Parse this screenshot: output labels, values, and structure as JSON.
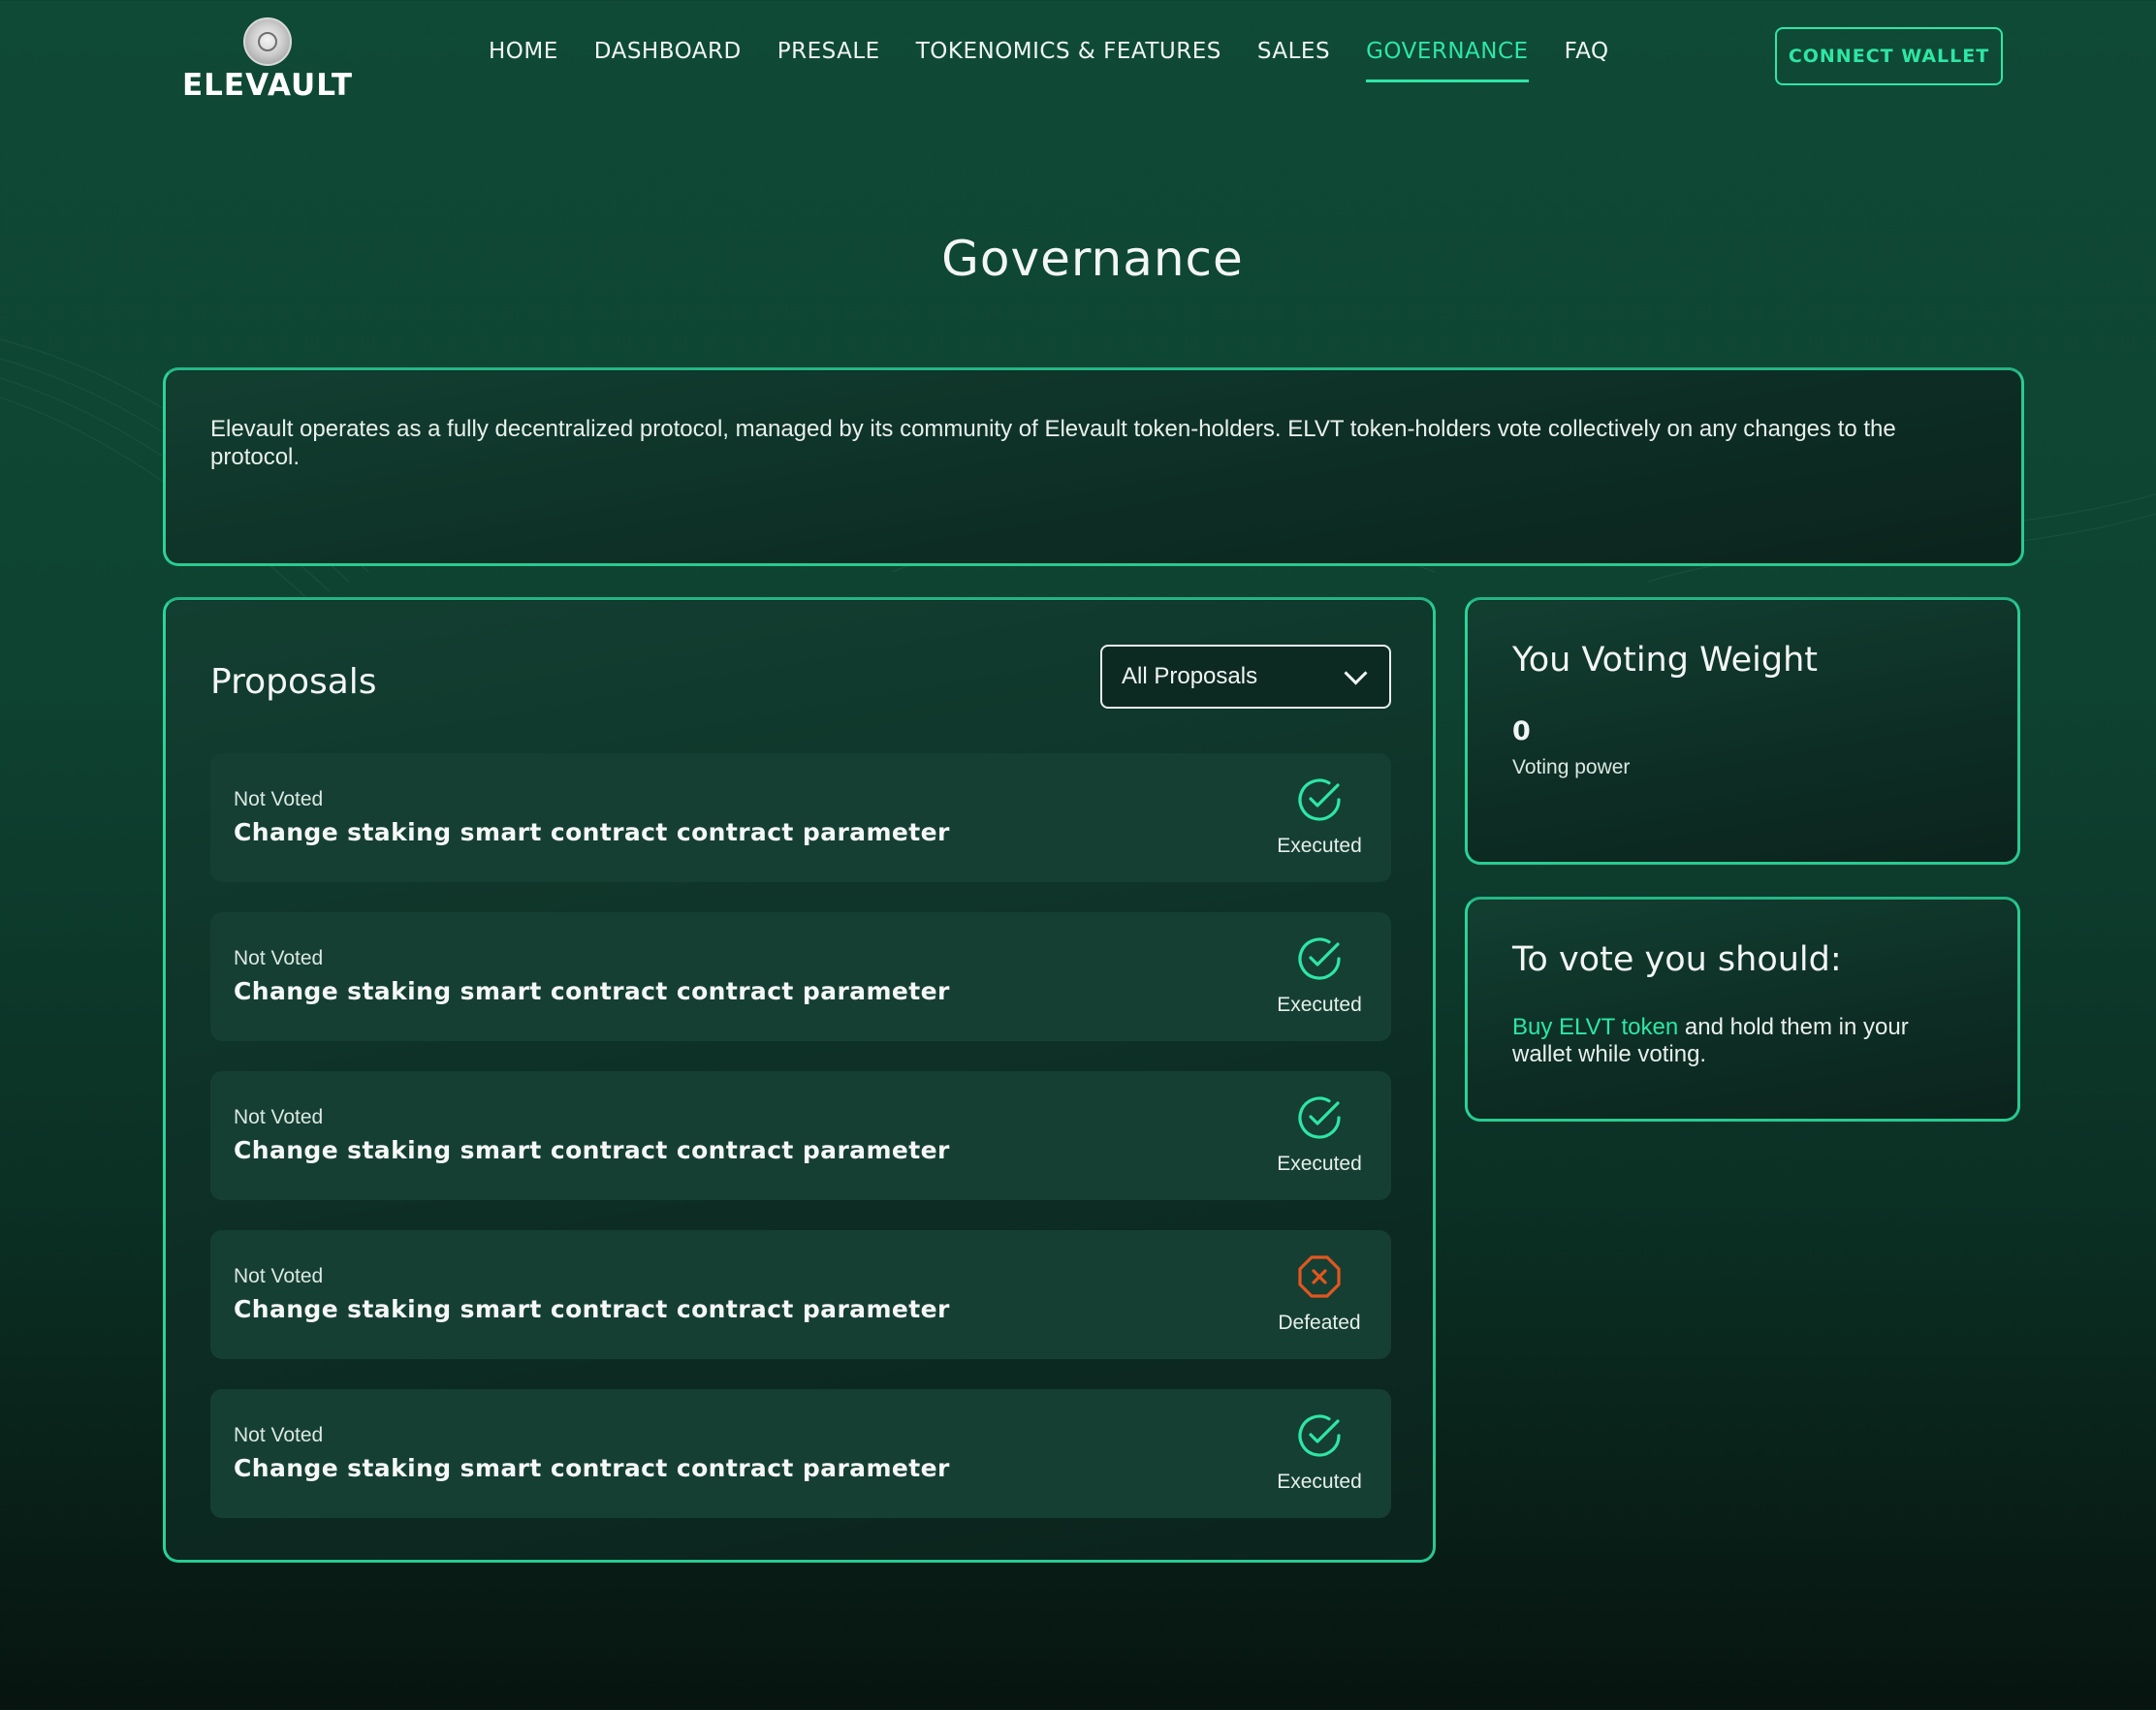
{
  "header": {
    "logo_text": "ELEVAULT",
    "nav": [
      {
        "label": "HOME",
        "active": false
      },
      {
        "label": "DASHBOARD",
        "active": false
      },
      {
        "label": "PRESALE",
        "active": false
      },
      {
        "label": "TOKENOMICS & FEATURES",
        "active": false
      },
      {
        "label": "SALES",
        "active": false
      },
      {
        "label": "GOVERNANCE",
        "active": true
      },
      {
        "label": "FAQ",
        "active": false
      }
    ],
    "connect_label": "CONNECT WALLET"
  },
  "page": {
    "title": "Governance",
    "intro": "Elevault operates as a fully decentralized protocol, managed by its community of Elevault token-holders.  ELVT token-holders vote collectively on any changes to the protocol."
  },
  "proposals": {
    "title": "Proposals",
    "filter_selected": "All Proposals",
    "items": [
      {
        "vote_status": "Not Voted",
        "title": "Change staking smart contract contract parameter",
        "state": "Executed",
        "icon": "check-circle-icon"
      },
      {
        "vote_status": "Not Voted",
        "title": "Change staking smart contract contract parameter",
        "state": "Executed",
        "icon": "check-circle-icon"
      },
      {
        "vote_status": "Not Voted",
        "title": "Change staking smart contract contract parameter",
        "state": "Executed",
        "icon": "check-circle-icon"
      },
      {
        "vote_status": "Not Voted",
        "title": "Change staking smart contract contract parameter",
        "state": "Defeated",
        "icon": "x-octagon-icon"
      },
      {
        "vote_status": "Not Voted",
        "title": "Change staking smart contract contract parameter",
        "state": "Executed",
        "icon": "check-circle-icon"
      }
    ]
  },
  "voting_weight": {
    "title": "You Voting Weight",
    "value": "0",
    "label": "Voting power"
  },
  "how_to_vote": {
    "title": "To vote you should:",
    "link_text": "Buy ELVT token",
    "rest_text": " and hold them in your wallet while voting."
  },
  "colors": {
    "accent": "#2ee6a6",
    "defeated": "#e3561f",
    "background_top": "#0f4a36",
    "background_bottom": "#07140f"
  }
}
